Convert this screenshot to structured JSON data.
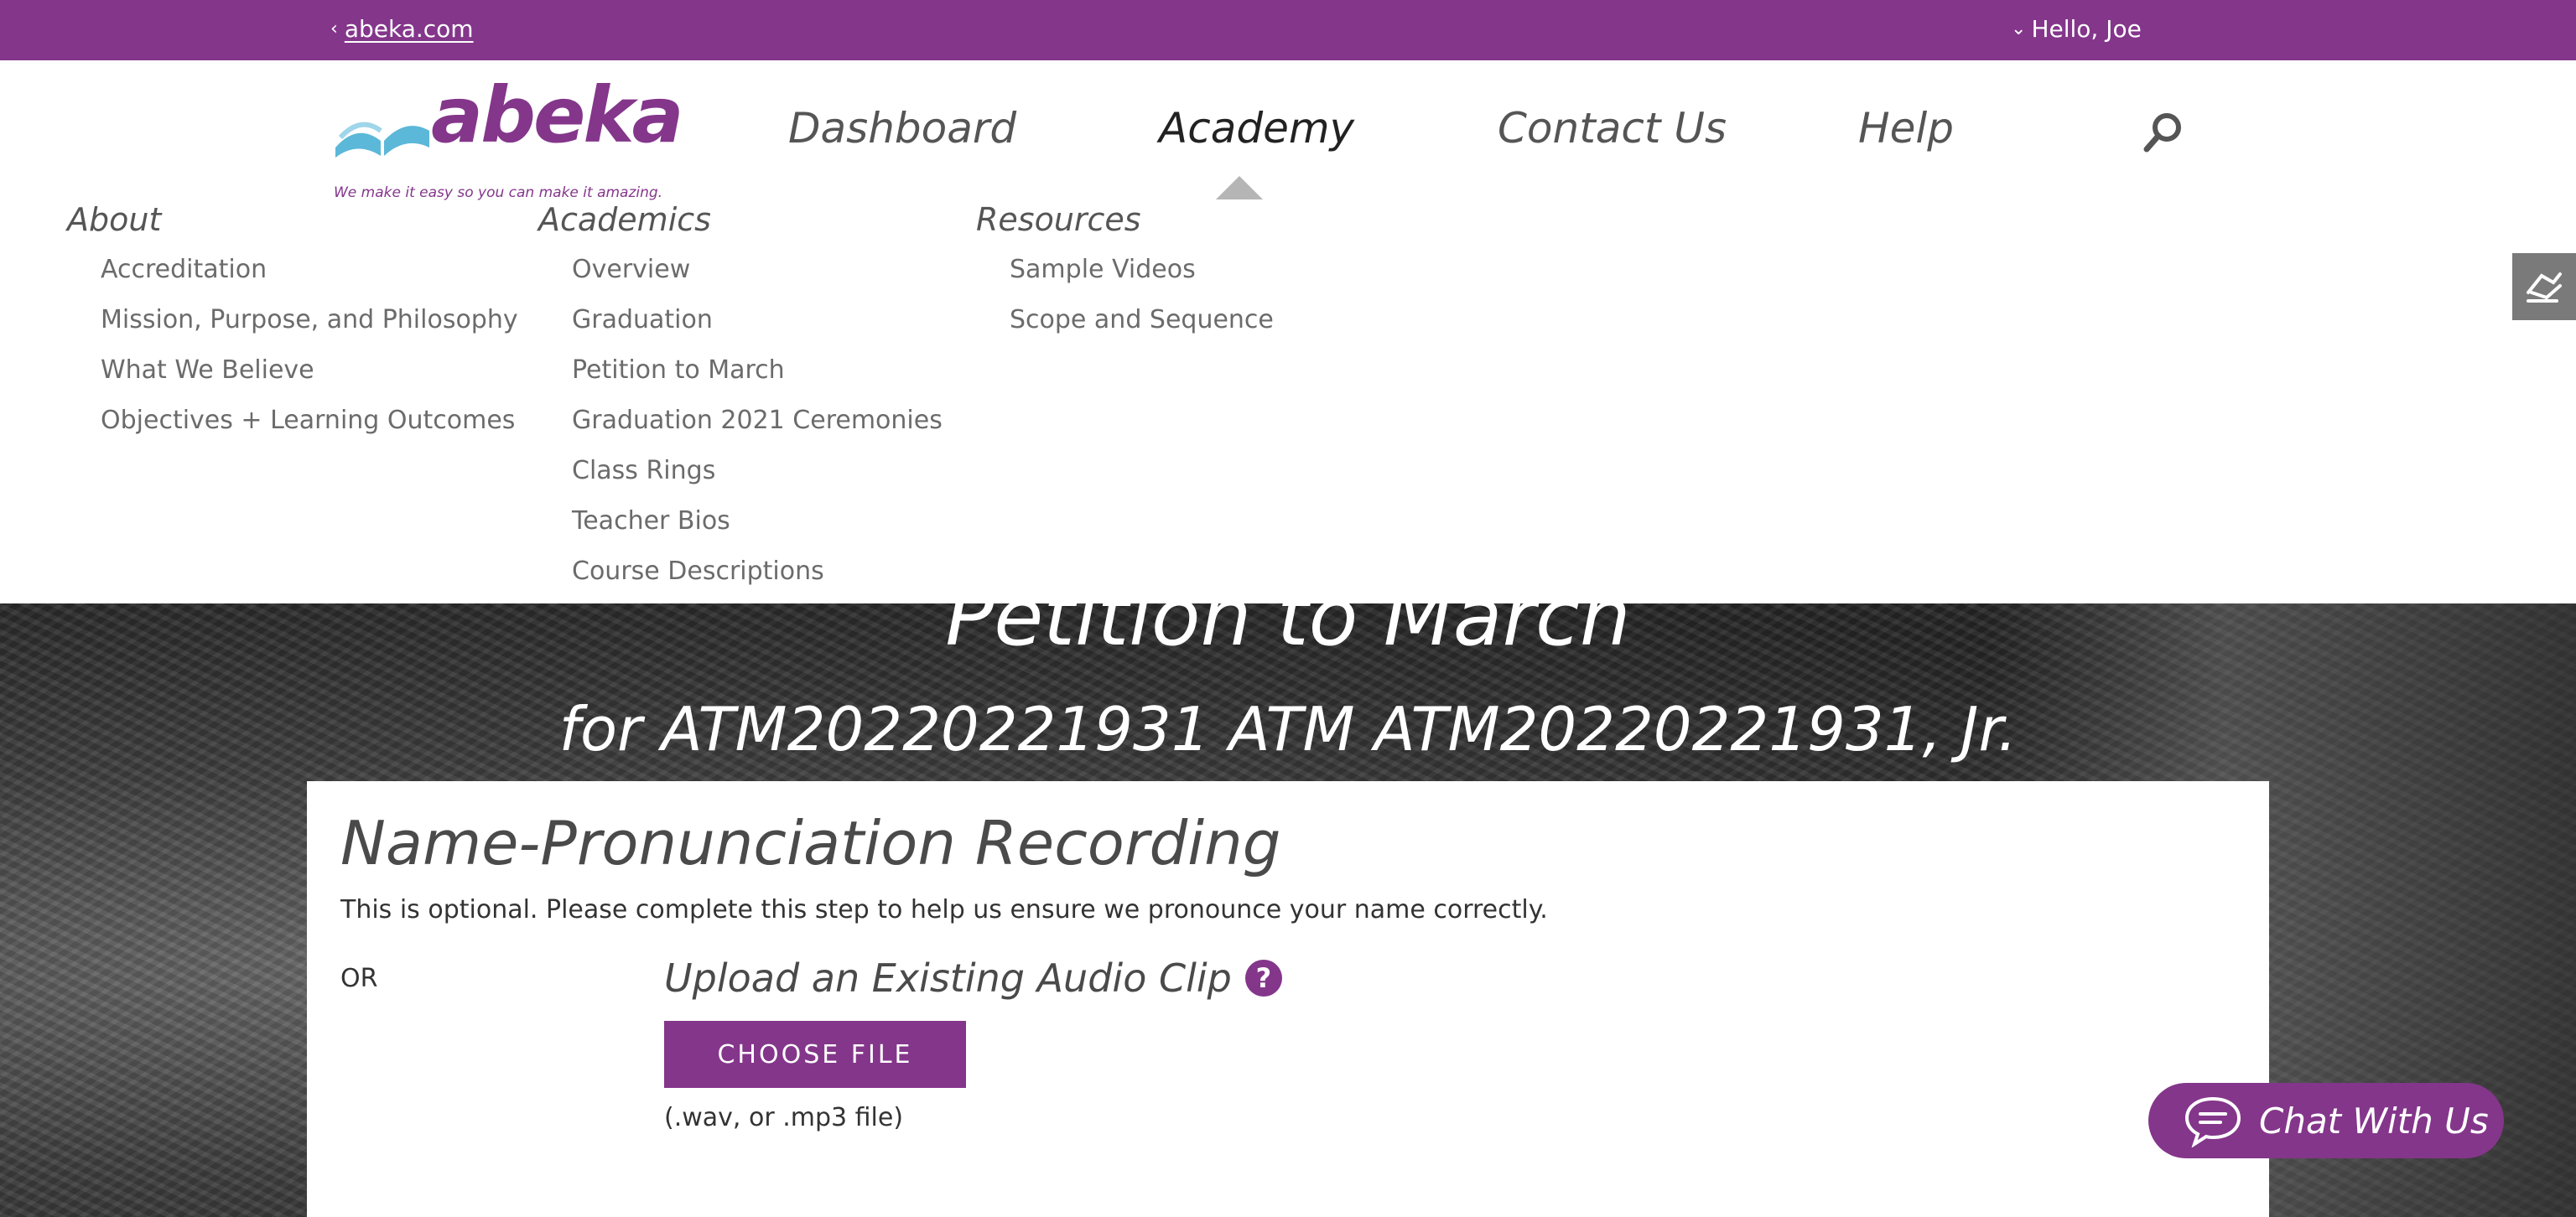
{
  "topbar": {
    "back_link": "abeka.com",
    "greeting": "Hello, Joe"
  },
  "logo": {
    "word": "abeka",
    "tagline": "We make it easy so you can make it amazing."
  },
  "nav": {
    "items": [
      {
        "label": "Dashboard"
      },
      {
        "label": "Academy",
        "active": true
      },
      {
        "label": "Contact Us"
      },
      {
        "label": "Help"
      }
    ]
  },
  "menu": {
    "about": {
      "heading": "About",
      "links": [
        "Accreditation",
        "Mission, Purpose, and Philosophy",
        "What We Believe",
        "Objectives + Learning Outcomes"
      ]
    },
    "academics": {
      "heading": "Academics",
      "links": [
        "Overview",
        "Graduation",
        "Petition to March",
        "Graduation 2021 Ceremonies",
        "Class Rings",
        "Teacher Bios",
        "Course Descriptions"
      ]
    },
    "resources": {
      "heading": "Resources",
      "links": [
        "Sample Videos",
        "Scope and Sequence"
      ]
    }
  },
  "hero": {
    "title": "Petition to March",
    "subtitle": "for ATM20220221931 ATM ATM20220221931, Jr."
  },
  "recording": {
    "heading": "Name-Pronunciation Recording",
    "description": "This is optional. Please complete this step to help us ensure we pronounce your name correctly.",
    "or_label": "OR",
    "upload_title": "Upload an Existing Audio Clip",
    "help_glyph": "?",
    "choose_file": "CHOOSE FILE",
    "formats": "(.wav, or .mp3 file)"
  },
  "chat": {
    "label": "Chat With Us"
  },
  "colors": {
    "brand_purple": "#84368b",
    "logo_blue": "#5bb8d8"
  },
  "icons": {
    "back": "chevron-left-icon",
    "account": "chevron-down-icon",
    "search": "search-icon",
    "help": "question-circle-icon",
    "chat": "chat-bubble-icon",
    "side": "accessibility-icon"
  }
}
